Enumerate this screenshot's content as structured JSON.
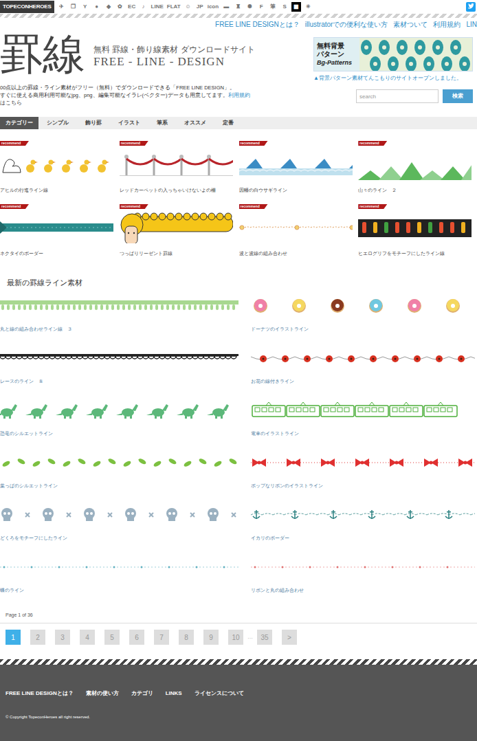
{
  "topbar": {
    "logo": "TOPECONHEROES",
    "icons": [
      {
        "glyph": "✈",
        "selected": false
      },
      {
        "glyph": "❐",
        "selected": false
      },
      {
        "glyph": "Y",
        "selected": false
      },
      {
        "glyph": "●",
        "selected": false
      },
      {
        "glyph": "◆",
        "selected": false
      },
      {
        "glyph": "✿",
        "selected": false
      },
      {
        "glyph": "EC",
        "selected": false
      },
      {
        "glyph": "♪",
        "selected": false
      },
      {
        "glyph": "LINE",
        "selected": false
      },
      {
        "glyph": "FLAT",
        "selected": false
      },
      {
        "glyph": "☺",
        "selected": false
      },
      {
        "glyph": "JP",
        "selected": false
      },
      {
        "glyph": "icon",
        "selected": false
      },
      {
        "glyph": "▬",
        "selected": false
      },
      {
        "glyph": "♜",
        "selected": false
      },
      {
        "glyph": "✺",
        "selected": false
      },
      {
        "glyph": "F",
        "selected": false
      },
      {
        "glyph": "筆",
        "selected": false
      },
      {
        "glyph": "S",
        "selected": false
      },
      {
        "glyph": "▦",
        "selected": true
      },
      {
        "glyph": "✳",
        "selected": false
      }
    ]
  },
  "nav": [
    "FREE LINE DESIGNとは？",
    "illustratorでの便利な使い方",
    "素材ついて",
    "利用規約",
    "LIN"
  ],
  "header": {
    "logo": "罫線",
    "subtitle": "無料 罫線・飾り線素材 ダウンロードサイト",
    "subtitle_en": "FREE - LINE - DESIGN",
    "line1": "00点以上の罫線・ライン素材がフリー（無料）でダウンロードできる「FREE LINE DESIGN」。",
    "line2": "すぐに使える商用利用可能なjpg、png、編集可能なイラレ(ベクター)データも用意してます。",
    "link": "利用規約",
    "line3": "はこちら"
  },
  "banner": {
    "line1": "無料背景",
    "line2": "パターン",
    "line3": "Bg-Patterns",
    "note": "▲背景パターン素材てんこもりのサイトオープンしました。"
  },
  "search": {
    "placeholder": "search",
    "button": "検索"
  },
  "tabs": [
    {
      "label": "カテゴリー",
      "selected": true
    },
    {
      "label": "シンプル",
      "selected": false
    },
    {
      "label": "飾り罫",
      "selected": false
    },
    {
      "label": "イラスト",
      "selected": false
    },
    {
      "label": "筆系",
      "selected": false
    },
    {
      "label": "オススメ",
      "selected": false
    },
    {
      "label": "定番",
      "selected": false
    }
  ],
  "recommend": {
    "tag": "recommend",
    "items": [
      {
        "title": "アヒルの行進ライン線",
        "kind": "duck",
        "color": "#f2c230"
      },
      {
        "title": "レッドカーペットの入っちゃいけないよの柵",
        "kind": "rope",
        "color": "#b8242a"
      },
      {
        "title": "因幡の白ウサギライン",
        "kind": "waves",
        "color": "#3a8cc4"
      },
      {
        "title": "山々のライン　２",
        "kind": "mountain",
        "color": "#5cb85c"
      },
      {
        "title": "ネクタイのボーダー",
        "kind": "tie",
        "color": "#2a8c8c"
      },
      {
        "title": "つっぱりリーゼント罫線",
        "kind": "hair",
        "color": "#f5c518"
      },
      {
        "title": "波と波線の組み合わせ",
        "kind": "wavy",
        "color": "#e0a060"
      },
      {
        "title": "ヒエログリフをモチーフにしたライン線",
        "kind": "glyph",
        "color": "#222222"
      }
    ]
  },
  "latest": {
    "heading": "最新の罫線ライン素材",
    "items": [
      {
        "title": "丸と線の組み合わせライン線　３",
        "kind": "scallop",
        "color": "#a8d890"
      },
      {
        "title": "ドーナツのイラストライン",
        "kind": "donut",
        "color": "#f080a8"
      },
      {
        "title": "レースのライン　８",
        "kind": "lace",
        "color": "#222222"
      },
      {
        "title": "お花の線付きライン",
        "kind": "flower",
        "color": "#d83020"
      },
      {
        "title": "恐竜のシルエットライン",
        "kind": "dino",
        "color": "#5cb87a"
      },
      {
        "title": "電車のイラストライン",
        "kind": "train",
        "color": "#4caf3a"
      },
      {
        "title": "葉っぱのシルエットライン",
        "kind": "leaf",
        "color": "#7cc040"
      },
      {
        "title": "ポップなリボンのイラストライン",
        "kind": "ribbon",
        "color": "#e03030"
      },
      {
        "title": "どくろをモチーフにしたライン",
        "kind": "skull",
        "color": "#9ab0c0"
      },
      {
        "title": "イカリのボーダー",
        "kind": "anchor",
        "color": "#2a8080"
      },
      {
        "title": "蝶のライン",
        "kind": "tiny",
        "color": "#60b0c0"
      },
      {
        "title": "リボンと丸の組み合わせ",
        "kind": "tiny",
        "color": "#e07070"
      }
    ]
  },
  "pagination": {
    "summary": "Page 1 of 36",
    "pages": [
      {
        "label": "1",
        "selected": true,
        "kind": "page"
      },
      {
        "label": "2",
        "selected": false,
        "kind": "page"
      },
      {
        "label": "3",
        "selected": false,
        "kind": "page"
      },
      {
        "label": "4",
        "selected": false,
        "kind": "page"
      },
      {
        "label": "5",
        "selected": false,
        "kind": "page"
      },
      {
        "label": "6",
        "selected": false,
        "kind": "page"
      },
      {
        "label": "7",
        "selected": false,
        "kind": "page"
      },
      {
        "label": "8",
        "selected": false,
        "kind": "page"
      },
      {
        "label": "9",
        "selected": false,
        "kind": "page"
      },
      {
        "label": "10",
        "selected": false,
        "kind": "page"
      },
      {
        "label": "…",
        "selected": false,
        "kind": "ellipsis"
      },
      {
        "label": "35",
        "selected": false,
        "kind": "page"
      },
      {
        "label": ">",
        "selected": false,
        "kind": "page"
      }
    ]
  },
  "footer": {
    "links": [
      "FREE LINE DESIGNとは？",
      "素材の使い方",
      "カテゴリ",
      "LINKS",
      "ライセンスについて"
    ],
    "copyright": "© Copyright TopeconHeroes all right reserved."
  }
}
